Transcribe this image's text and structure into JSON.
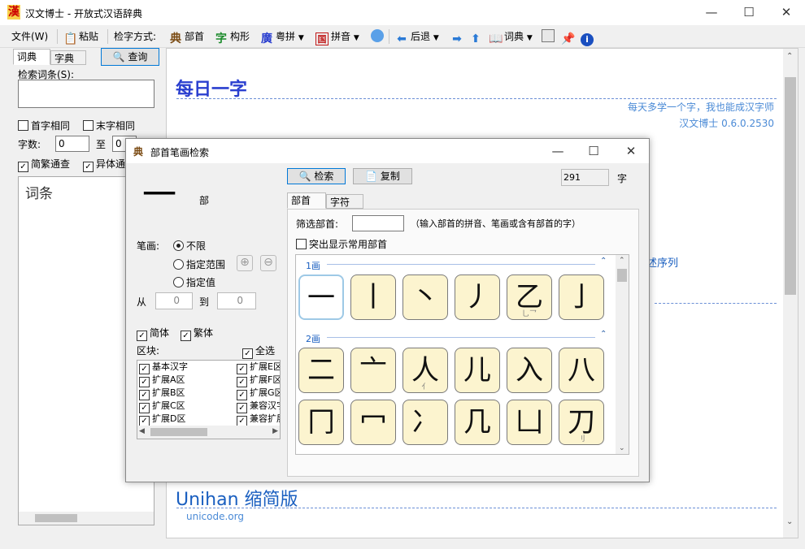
{
  "window": {
    "title": "汉文博士 - 开放式汉语辞典",
    "app_icon_char": "漢"
  },
  "menu": {
    "file": "文件(W)",
    "paste": "粘贴",
    "search_mode": "检字方式:",
    "bushou": "部首",
    "goxing": "构形",
    "duopin": "粤拼",
    "pinyin": "拼音",
    "back": "后退",
    "cidian": "词典"
  },
  "left": {
    "tabs": [
      "词典",
      "字典"
    ],
    "query_button": "查询",
    "search_label": "检索词条(S):",
    "search_value": "",
    "first_same": "首字相同",
    "last_same": "末字相同",
    "char_count_label": "字数:",
    "char_from": "0",
    "char_to_label": "至",
    "char_to": "0",
    "simp_trad": "简繁通查",
    "variant": "异体通",
    "list_header": "词条"
  },
  "content": {
    "daily_title": "每日一字",
    "line1": "每天多学一个字，我也能成汉字师",
    "line2": "汉文博士 0.6.0.2530",
    "partial_link": "述序列",
    "unihan_title": "Unihan 缩简版",
    "unihan_link": "unicode.org"
  },
  "dialog": {
    "title": "部首笔画检索",
    "preview_char": "一",
    "preview_label": "部",
    "search_button": "检索",
    "copy_button": "复制",
    "count": "291",
    "count_unit": "字",
    "tabs": [
      "部首",
      "字符"
    ],
    "filter_label": "筛选部首:",
    "filter_value": "",
    "filter_hint": "（输入部首的拼音、笔画或含有部首的字）",
    "highlight_common": "突出显示常用部首",
    "stroke_label": "笔画:",
    "radio_unlimited": "不限",
    "radio_range": "指定范围",
    "radio_value": "指定值",
    "from_label": "从",
    "from_value": "0",
    "to_label": "到",
    "to_value": "0",
    "simplified": "简体",
    "traditional": "繁体",
    "block_label": "区块:",
    "select_all": "全选",
    "blocks_left": [
      "基本汉字",
      "扩展A区",
      "扩展B区",
      "扩展C区",
      "扩展D区"
    ],
    "blocks_right": [
      "扩展E区",
      "扩展F区",
      "扩展G区",
      "兼容汉字",
      "兼容扩展"
    ],
    "group1_label": "1画",
    "group1": [
      {
        "char": "一",
        "sub": ""
      },
      {
        "char": "丨",
        "sub": ""
      },
      {
        "char": "丶",
        "sub": ""
      },
      {
        "char": "丿",
        "sub": ""
      },
      {
        "char": "乙",
        "sub": "乚乛"
      },
      {
        "char": "亅",
        "sub": ""
      }
    ],
    "group2_label": "2画",
    "group2_row1": [
      {
        "char": "二",
        "sub": ""
      },
      {
        "char": "亠",
        "sub": ""
      },
      {
        "char": "人",
        "sub": "亻"
      },
      {
        "char": "儿",
        "sub": ""
      },
      {
        "char": "入",
        "sub": ""
      },
      {
        "char": "八",
        "sub": ""
      }
    ],
    "group2_row2": [
      {
        "char": "冂",
        "sub": ""
      },
      {
        "char": "冖",
        "sub": ""
      },
      {
        "char": "冫",
        "sub": ""
      },
      {
        "char": "几",
        "sub": ""
      },
      {
        "char": "凵",
        "sub": ""
      },
      {
        "char": "刀",
        "sub": "刂"
      }
    ]
  },
  "colors": {
    "accent": "#1a5fc0",
    "title_blue": "#2a3fcf",
    "link": "#4a8ad6",
    "card_bg": "#fcf4cf"
  }
}
